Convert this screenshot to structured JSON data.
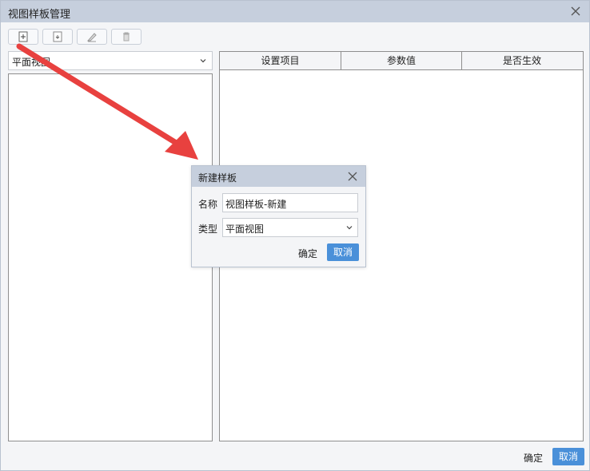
{
  "window": {
    "title": "视图样板管理"
  },
  "toolbar": {
    "items": [
      "new-icon",
      "import-icon",
      "edit-icon",
      "delete-icon"
    ]
  },
  "left": {
    "selected_type": "平面视图"
  },
  "grid": {
    "columns": [
      "设置项目",
      "参数值",
      "是否生效"
    ]
  },
  "footer": {
    "ok": "确定",
    "cancel": "取消"
  },
  "dialog": {
    "title": "新建样板",
    "name_label": "名称",
    "name_value": "视图样板-新建",
    "type_label": "类型",
    "type_value": "平面视图",
    "ok": "确定",
    "cancel": "取消"
  },
  "colors": {
    "titlebar": "#c6cfdd",
    "accent": "#4a90d9",
    "annotation_arrow": "#e8413f"
  }
}
